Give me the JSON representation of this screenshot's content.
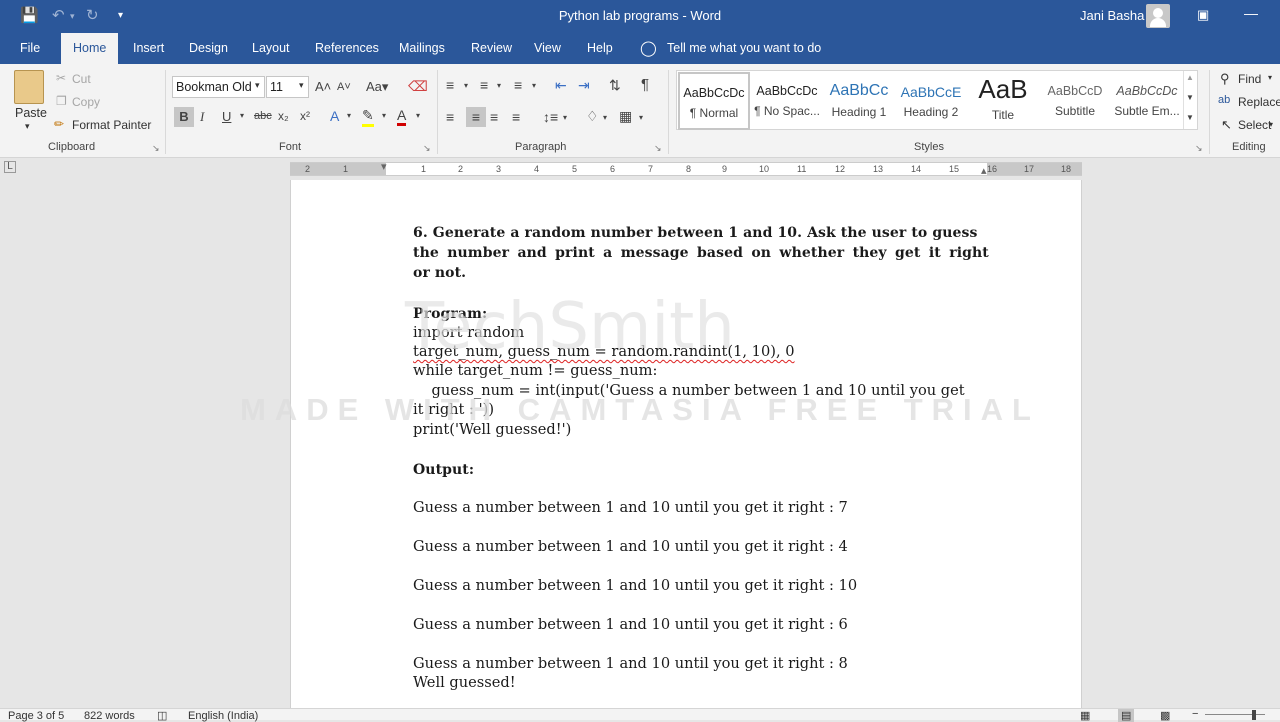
{
  "titlebar": {
    "doc_title": "Python lab programs  -  Word",
    "user": "Jani Basha"
  },
  "menu": {
    "tabs": [
      "File",
      "Home",
      "Insert",
      "Design",
      "Layout",
      "References",
      "Mailings",
      "Review",
      "View",
      "Help"
    ],
    "active": "Home",
    "tell_me": "Tell me what you want to do"
  },
  "clipboard": {
    "paste": "Paste",
    "cut": "Cut",
    "copy": "Copy",
    "format_painter": "Format Painter",
    "label": "Clipboard"
  },
  "font": {
    "name": "Bookman Old",
    "size": "11",
    "label": "Font"
  },
  "paragraph": {
    "label": "Paragraph"
  },
  "styles": {
    "label": "Styles",
    "items": [
      {
        "sample": "AaBbCcDc",
        "name": "¶ Normal"
      },
      {
        "sample": "AaBbCcDc",
        "name": "¶ No Spac..."
      },
      {
        "sample": "AaBbCc",
        "name": "Heading 1"
      },
      {
        "sample": "AaBbCcE",
        "name": "Heading 2"
      },
      {
        "sample": "AaB",
        "name": "Title"
      },
      {
        "sample": "AaBbCcD",
        "name": "Subtitle"
      },
      {
        "sample": "AaBbCcDc",
        "name": "Subtle Em..."
      }
    ]
  },
  "editing": {
    "find": "Find",
    "replace": "Replace",
    "select": "Select",
    "label": "Editing"
  },
  "ruler": {
    "numbers": [
      "2",
      "1",
      "1",
      "2",
      "3",
      "4",
      "5",
      "6",
      "7",
      "8",
      "9",
      "10",
      "11",
      "12",
      "13",
      "14",
      "15",
      "16",
      "17",
      "18"
    ]
  },
  "document": {
    "heading": [
      "6. Generate a random number between 1 and 10. Ask the user to guess",
      "the number and print a message based on whether they get it right",
      "or not."
    ],
    "program_label": "Program:",
    "code": [
      "import random",
      "target_num, guess_num = random.randint(1, 10), 0",
      "while target_num != guess_num:",
      "    guess_num = int(input('Guess a number between 1 and 10 until you get",
      "it right : '))",
      "print('Well guessed!')"
    ],
    "output_label": "Output:",
    "output": [
      "Guess a number between 1 and 10 until you get it right : 7",
      "Guess a number between 1 and 10 until you get it right : 4",
      "Guess a number between 1 and 10 until you get it right : 10",
      "Guess a number between 1 and 10 until you get it right : 6",
      "Guess a number between 1 and 10 until you get it right : 8",
      "Well guessed!"
    ]
  },
  "watermark": {
    "logo": "TechSmith",
    "text": "MADE WITH CAMTASIA FREE TRIAL"
  },
  "status": {
    "page": "Page 3 of 5",
    "words": "822 words",
    "language": "English (India)"
  },
  "colors": {
    "accent": "#2b579a",
    "ribbon": "#f3f3f3",
    "font_color": "#d00000",
    "highlight": "#ffff00"
  }
}
